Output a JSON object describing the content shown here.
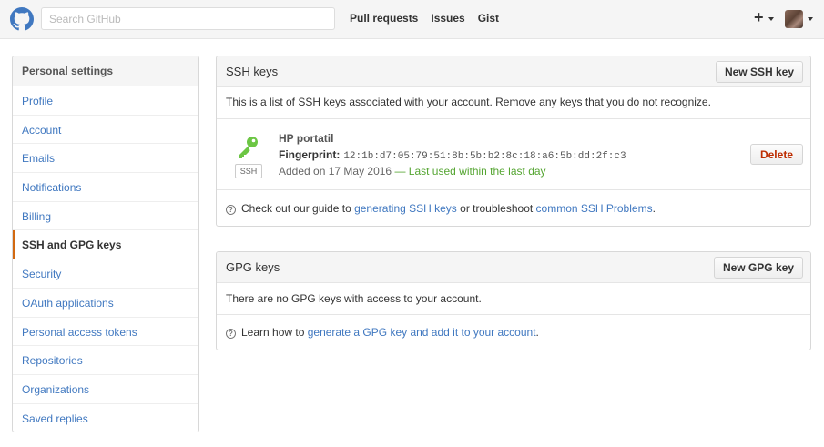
{
  "header": {
    "search_placeholder": "Search GitHub",
    "nav": [
      "Pull requests",
      "Issues",
      "Gist"
    ],
    "new_label": "+"
  },
  "sidebar": {
    "title": "Personal settings",
    "items": [
      {
        "label": "Profile",
        "selected": false
      },
      {
        "label": "Account",
        "selected": false
      },
      {
        "label": "Emails",
        "selected": false
      },
      {
        "label": "Notifications",
        "selected": false
      },
      {
        "label": "Billing",
        "selected": false
      },
      {
        "label": "SSH and GPG keys",
        "selected": true
      },
      {
        "label": "Security",
        "selected": false
      },
      {
        "label": "OAuth applications",
        "selected": false
      },
      {
        "label": "Personal access tokens",
        "selected": false
      },
      {
        "label": "Repositories",
        "selected": false
      },
      {
        "label": "Organizations",
        "selected": false
      },
      {
        "label": "Saved replies",
        "selected": false
      }
    ],
    "accent_color": "#d26911"
  },
  "ssh": {
    "title": "SSH keys",
    "new_button": "New SSH key",
    "description": "This is a list of SSH keys associated with your account. Remove any keys that you do not recognize.",
    "key": {
      "icon": "key-icon",
      "badge": "SSH",
      "title": "HP portatil",
      "fingerprint_label": "Fingerprint:",
      "fingerprint": "12:1b:d7:05:79:51:8b:5b:b2:8c:18:a6:5b:dd:2f:c3",
      "added": "Added on 17 May 2016",
      "sep": " — ",
      "last_used": "Last used within the last day",
      "delete_label": "Delete"
    },
    "help": {
      "prefix": "Check out our guide to ",
      "link1": "generating SSH keys",
      "middle": " or troubleshoot ",
      "link2": "common SSH Problems",
      "suffix": "."
    }
  },
  "gpg": {
    "title": "GPG keys",
    "new_button": "New GPG key",
    "empty": "There are no GPG keys with access to your account.",
    "help": {
      "prefix": "Learn how to ",
      "link": "generate a GPG key and add it to your account",
      "suffix": "."
    }
  },
  "colors": {
    "link": "#4078c0",
    "green": "#55a532",
    "danger": "#bd2c00",
    "key_green": "#6cc644"
  }
}
